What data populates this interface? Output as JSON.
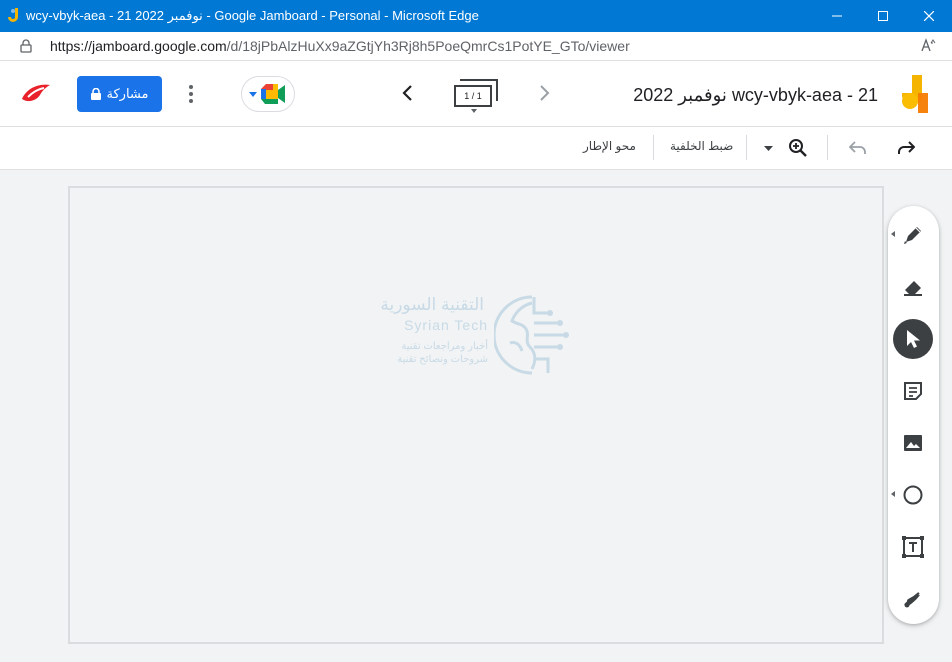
{
  "window": {
    "title": "wcy-vbyk-aea - 21 نوفمبر 2022 - Google Jamboard - Personal - Microsoft Edge"
  },
  "address": {
    "url_host": "https://jamboard.google.com",
    "url_path": "/d/18jPbAlzHuXx9aZGtjYh3Rj8h5PoeQmrCs1PotYE_GTo/viewer"
  },
  "header": {
    "share_label": "مشاركة",
    "frame_counter": "1 / 1",
    "doc_title": "wcy-vbyk-aea - 21 نوفمبر 2022"
  },
  "toolbar": {
    "set_background": "ضبط الخلفية",
    "clear_frame": "محو الإطار"
  },
  "watermark": {
    "arabic_name": "التقنية السورية",
    "english_name": "Syrian Tech",
    "subtitle_1": "أخبار ومراجعات تقنية",
    "subtitle_2": "شروحات ونصائح تقنية"
  },
  "side_tools": [
    "pen-icon",
    "eraser-icon",
    "select-icon",
    "sticky-note-icon",
    "image-icon",
    "circle-icon",
    "text-box-icon",
    "laser-icon"
  ],
  "colors": {
    "edge_titlebar": "#0078d4",
    "share_button": "#1a73e8",
    "active_tool": "#3c4043"
  }
}
